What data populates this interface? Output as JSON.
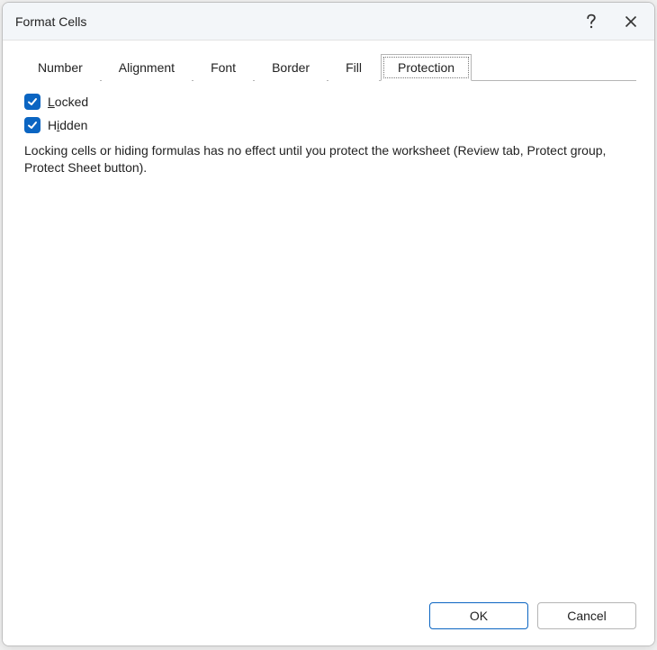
{
  "title": "Format Cells",
  "tabs": [
    {
      "label": "Number",
      "active": false
    },
    {
      "label": "Alignment",
      "active": false
    },
    {
      "label": "Font",
      "active": false
    },
    {
      "label": "Border",
      "active": false
    },
    {
      "label": "Fill",
      "active": false
    },
    {
      "label": "Protection",
      "active": true
    }
  ],
  "protection": {
    "locked_pre": "L",
    "locked_rest": "ocked",
    "hidden_pre": "H",
    "hidden_key": "i",
    "hidden_rest": "dden",
    "info": "Locking cells or hiding formulas has no effect until you protect the worksheet (Review tab, Protect group, Protect Sheet button)."
  },
  "buttons": {
    "ok": "OK",
    "cancel": "Cancel"
  },
  "colors": {
    "accent": "#0b65c2"
  }
}
